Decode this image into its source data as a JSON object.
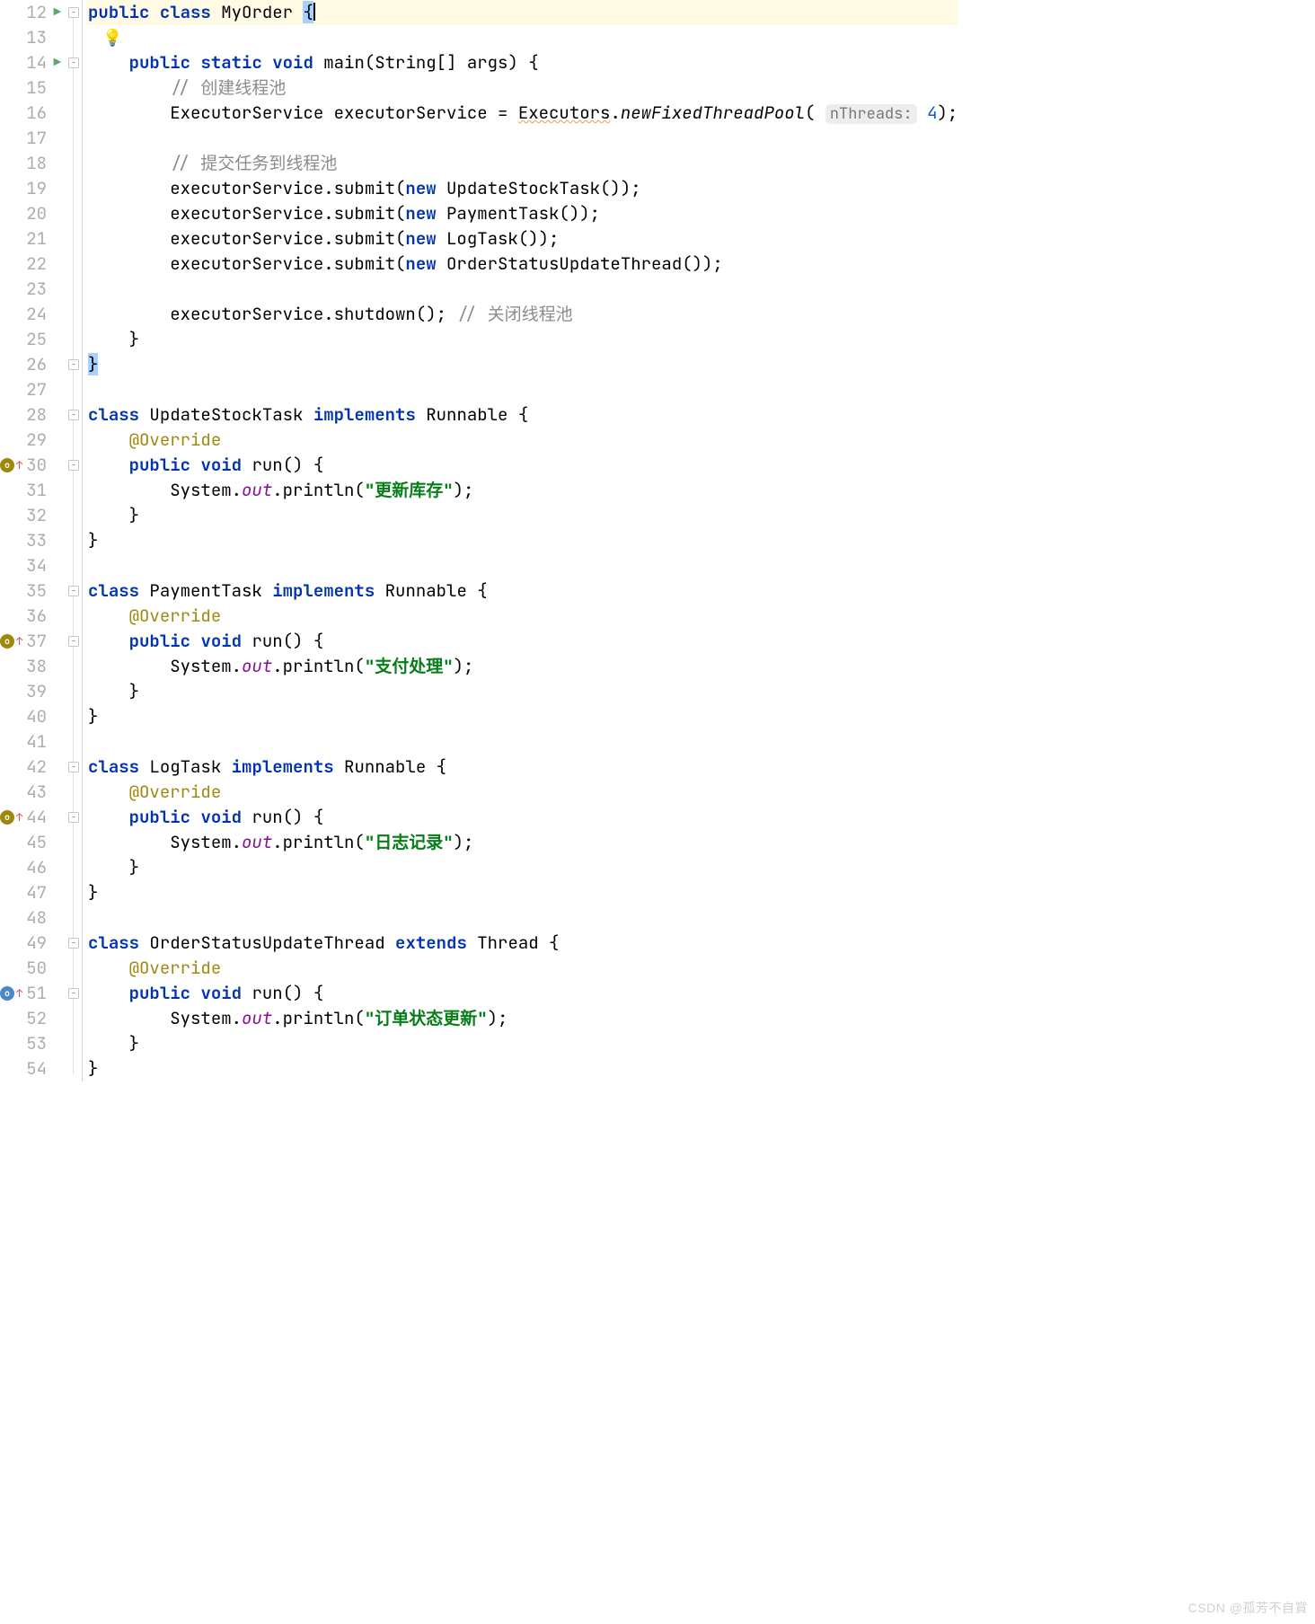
{
  "watermark": "CSDN @孤芳不自賞",
  "hints": {
    "nThreads": "nThreads:"
  },
  "lines": [
    {
      "n": 12,
      "run": true,
      "tokens": [
        {
          "kind": "kw",
          "t": "public"
        },
        {
          "t": " "
        },
        {
          "kind": "kw",
          "t": "class"
        },
        {
          "t": " MyOrder "
        },
        {
          "kind": "sel",
          "t": "{"
        },
        {
          "kind": "caret"
        }
      ],
      "hl": true
    },
    {
      "n": 13,
      "bulb": true,
      "tokens": []
    },
    {
      "n": 14,
      "run": true,
      "tokens": [
        {
          "t": "    "
        },
        {
          "kind": "kw",
          "t": "public"
        },
        {
          "t": " "
        },
        {
          "kind": "kw",
          "t": "static"
        },
        {
          "t": " "
        },
        {
          "kind": "kw",
          "t": "void"
        },
        {
          "t": " main(String[] args) {"
        }
      ]
    },
    {
      "n": 15,
      "tokens": [
        {
          "t": "        "
        },
        {
          "kind": "cmt",
          "t": "// 创建线程池"
        }
      ]
    },
    {
      "n": 16,
      "tokens": [
        {
          "t": "        ExecutorService executorService = "
        },
        {
          "kind": "sq",
          "t": "Executors"
        },
        {
          "t": "."
        },
        {
          "kind": "ital",
          "t": "newFixedThreadPool"
        },
        {
          "t": "( "
        },
        {
          "kind": "hint",
          "t": "nThreads:"
        },
        {
          "t": " "
        },
        {
          "kind": "num",
          "t": "4"
        },
        {
          "t": ");"
        }
      ]
    },
    {
      "n": 17,
      "tokens": []
    },
    {
      "n": 18,
      "tokens": [
        {
          "t": "        "
        },
        {
          "kind": "cmt",
          "t": "// 提交任务到线程池"
        }
      ]
    },
    {
      "n": 19,
      "tokens": [
        {
          "t": "        executorService.submit("
        },
        {
          "kind": "kw",
          "t": "new"
        },
        {
          "t": " UpdateStockTask());"
        }
      ]
    },
    {
      "n": 20,
      "tokens": [
        {
          "t": "        executorService.submit("
        },
        {
          "kind": "kw",
          "t": "new"
        },
        {
          "t": " PaymentTask());"
        }
      ]
    },
    {
      "n": 21,
      "tokens": [
        {
          "t": "        executorService.submit("
        },
        {
          "kind": "kw",
          "t": "new"
        },
        {
          "t": " LogTask());"
        }
      ]
    },
    {
      "n": 22,
      "tokens": [
        {
          "t": "        executorService.submit("
        },
        {
          "kind": "kw",
          "t": "new"
        },
        {
          "t": " OrderStatusUpdateThread());"
        }
      ]
    },
    {
      "n": 23,
      "tokens": []
    },
    {
      "n": 24,
      "tokens": [
        {
          "t": "        executorService.shutdown(); "
        },
        {
          "kind": "cmt",
          "t": "// 关闭线程池"
        }
      ]
    },
    {
      "n": 25,
      "tokens": [
        {
          "t": "    }"
        }
      ]
    },
    {
      "n": 26,
      "tokens": [
        {
          "kind": "sel",
          "t": "}"
        }
      ]
    },
    {
      "n": 27,
      "tokens": []
    },
    {
      "n": 28,
      "tokens": [
        {
          "kind": "kw",
          "t": "class"
        },
        {
          "t": " UpdateStockTask "
        },
        {
          "kind": "kw",
          "t": "implements"
        },
        {
          "t": " Runnable {"
        }
      ]
    },
    {
      "n": 29,
      "tokens": [
        {
          "t": "    "
        },
        {
          "kind": "anno",
          "t": "@Override"
        }
      ]
    },
    {
      "n": 30,
      "impl": "o",
      "tokens": [
        {
          "t": "    "
        },
        {
          "kind": "kw",
          "t": "public"
        },
        {
          "t": " "
        },
        {
          "kind": "kw",
          "t": "void"
        },
        {
          "t": " run() {"
        }
      ]
    },
    {
      "n": 31,
      "tokens": [
        {
          "t": "        System."
        },
        {
          "kind": "out",
          "t": "out"
        },
        {
          "t": ".println("
        },
        {
          "kind": "str",
          "t": "\"更新库存\""
        },
        {
          "t": ");"
        }
      ]
    },
    {
      "n": 32,
      "tokens": [
        {
          "t": "    }"
        }
      ]
    },
    {
      "n": 33,
      "tokens": [
        {
          "t": "}"
        }
      ]
    },
    {
      "n": 34,
      "tokens": []
    },
    {
      "n": 35,
      "tokens": [
        {
          "kind": "kw",
          "t": "class"
        },
        {
          "t": " PaymentTask "
        },
        {
          "kind": "kw",
          "t": "implements"
        },
        {
          "t": " Runnable {"
        }
      ]
    },
    {
      "n": 36,
      "tokens": [
        {
          "t": "    "
        },
        {
          "kind": "anno",
          "t": "@Override"
        }
      ]
    },
    {
      "n": 37,
      "impl": "o",
      "tokens": [
        {
          "t": "    "
        },
        {
          "kind": "kw",
          "t": "public"
        },
        {
          "t": " "
        },
        {
          "kind": "kw",
          "t": "void"
        },
        {
          "t": " run() {"
        }
      ]
    },
    {
      "n": 38,
      "tokens": [
        {
          "t": "        System."
        },
        {
          "kind": "out",
          "t": "out"
        },
        {
          "t": ".println("
        },
        {
          "kind": "str",
          "t": "\"支付处理\""
        },
        {
          "t": ");"
        }
      ]
    },
    {
      "n": 39,
      "tokens": [
        {
          "t": "    }"
        }
      ]
    },
    {
      "n": 40,
      "tokens": [
        {
          "t": "}"
        }
      ]
    },
    {
      "n": 41,
      "tokens": []
    },
    {
      "n": 42,
      "tokens": [
        {
          "kind": "kw",
          "t": "class"
        },
        {
          "t": " LogTask "
        },
        {
          "kind": "kw",
          "t": "implements"
        },
        {
          "t": " Runnable {"
        }
      ]
    },
    {
      "n": 43,
      "tokens": [
        {
          "t": "    "
        },
        {
          "kind": "anno",
          "t": "@Override"
        }
      ]
    },
    {
      "n": 44,
      "impl": "o",
      "tokens": [
        {
          "t": "    "
        },
        {
          "kind": "kw",
          "t": "public"
        },
        {
          "t": " "
        },
        {
          "kind": "kw",
          "t": "void"
        },
        {
          "t": " run() {"
        }
      ]
    },
    {
      "n": 45,
      "tokens": [
        {
          "t": "        System."
        },
        {
          "kind": "out",
          "t": "out"
        },
        {
          "t": ".println("
        },
        {
          "kind": "str",
          "t": "\"日志记录\""
        },
        {
          "t": ");"
        }
      ]
    },
    {
      "n": 46,
      "tokens": [
        {
          "t": "    }"
        }
      ]
    },
    {
      "n": 47,
      "tokens": [
        {
          "t": "}"
        }
      ]
    },
    {
      "n": 48,
      "tokens": []
    },
    {
      "n": 49,
      "tokens": [
        {
          "kind": "kw",
          "t": "class"
        },
        {
          "t": " OrderStatusUpdateThread "
        },
        {
          "kind": "kw",
          "t": "extends"
        },
        {
          "t": " Thread {"
        }
      ]
    },
    {
      "n": 50,
      "tokens": [
        {
          "t": "    "
        },
        {
          "kind": "anno",
          "t": "@Override"
        }
      ]
    },
    {
      "n": 51,
      "impl": "blue",
      "tokens": [
        {
          "t": "    "
        },
        {
          "kind": "kw",
          "t": "public"
        },
        {
          "t": " "
        },
        {
          "kind": "kw",
          "t": "void"
        },
        {
          "t": " run() {"
        }
      ]
    },
    {
      "n": 52,
      "tokens": [
        {
          "t": "        System."
        },
        {
          "kind": "out",
          "t": "out"
        },
        {
          "t": ".println("
        },
        {
          "kind": "str",
          "t": "\"订单状态更新\""
        },
        {
          "t": ");"
        }
      ]
    },
    {
      "n": 53,
      "tokens": [
        {
          "t": "    }"
        }
      ]
    },
    {
      "n": 54,
      "tokens": [
        {
          "t": "}"
        }
      ]
    }
  ]
}
